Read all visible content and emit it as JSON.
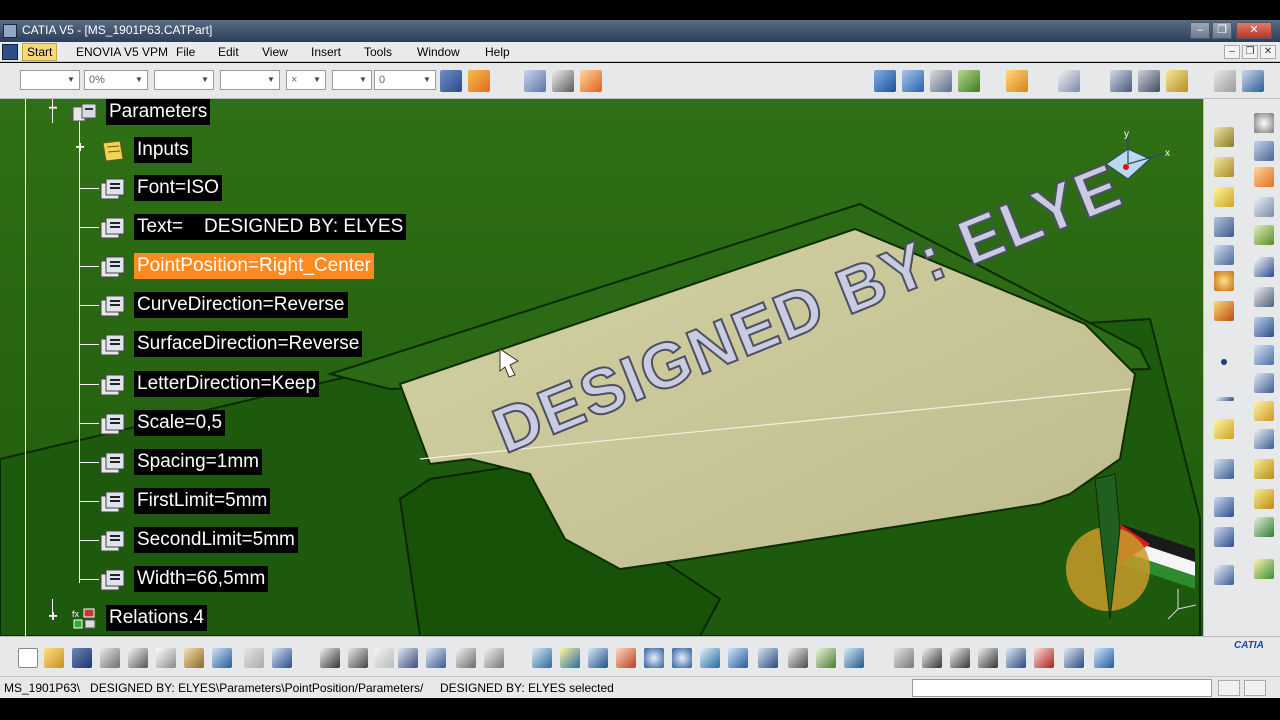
{
  "window": {
    "title": "CATIA V5 - [MS_1901P63.CATPart]",
    "controls": {
      "minimize": "–",
      "restore": "❐",
      "close": "✕"
    }
  },
  "menu": {
    "items": [
      "Start",
      "ENOVIA V5 VPM",
      "File",
      "Edit",
      "View",
      "Insert",
      "Tools",
      "Window",
      "Help"
    ],
    "mdi_controls": [
      "–",
      "❐",
      "✕"
    ]
  },
  "toolbar": {
    "color_combo": "",
    "transparency_combo": "0%",
    "linetype_combo": "",
    "thickness_combo": "",
    "point_combo": "×",
    "layer_combo": "0"
  },
  "tree": {
    "root": {
      "label": "Parameters"
    },
    "inputs": {
      "label": "Inputs"
    },
    "items": [
      {
        "label": "Font=ISO"
      },
      {
        "label": "Text=    DESIGNED BY: ELYES"
      },
      {
        "label": "PointPosition=Right_Center",
        "selected": true
      },
      {
        "label": "CurveDirection=Reverse"
      },
      {
        "label": "SurfaceDirection=Reverse"
      },
      {
        "label": "LetterDirection=Keep"
      },
      {
        "label": "Scale=0,5"
      },
      {
        "label": "Spacing=1mm"
      },
      {
        "label": "FirstLimit=5mm"
      },
      {
        "label": "SecondLimit=5mm"
      },
      {
        "label": "Width=66,5mm"
      }
    ],
    "relations": {
      "label": "Relations.4"
    }
  },
  "model": {
    "engraved_text": "DESIGNED BY: ELYE",
    "colors": {
      "background": "#2f6e17",
      "face": "#c8c79a",
      "solid": "#1f5e0e",
      "letters": "#c9cbe0"
    }
  },
  "compass": {
    "x_label": "x",
    "y_label": "y"
  },
  "status": {
    "text": "MS_1901P63\\   DESIGNED BY: ELYES\\Parameters\\PointPosition/Parameters/     DESIGNED BY: ELYES selected"
  },
  "brand": {
    "logo_text": "CATIA"
  }
}
